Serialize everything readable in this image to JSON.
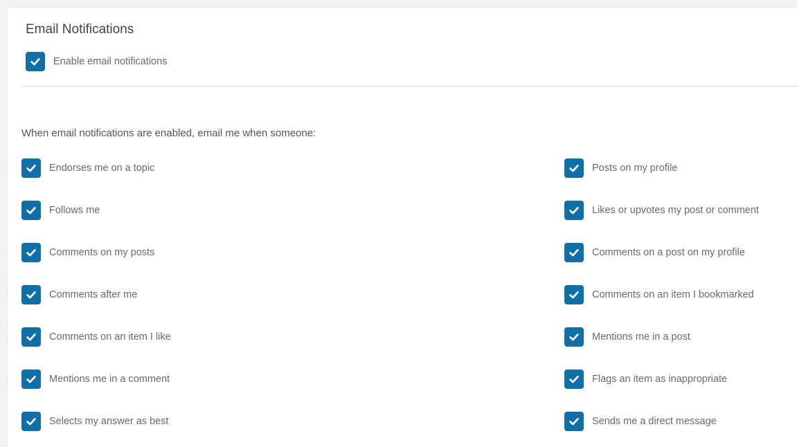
{
  "section": {
    "title": "Email Notifications",
    "enable_label": "Enable email notifications",
    "enable_checked": true
  },
  "intro": "When email notifications are enabled, email me when someone:",
  "options": {
    "left": [
      {
        "label": "Endorses me on a topic",
        "checked": true
      },
      {
        "label": "Follows me",
        "checked": true
      },
      {
        "label": "Comments on my posts",
        "checked": true
      },
      {
        "label": "Comments after me",
        "checked": true
      },
      {
        "label": "Comments on an item I like",
        "checked": true
      },
      {
        "label": "Mentions me in a comment",
        "checked": true
      },
      {
        "label": "Selects my answer as best",
        "checked": true
      }
    ],
    "right": [
      {
        "label": "Posts on my profile",
        "checked": true
      },
      {
        "label": "Likes or upvotes my post or comment",
        "checked": true
      },
      {
        "label": "Comments on a post on my profile",
        "checked": true
      },
      {
        "label": "Comments on an item I bookmarked",
        "checked": true
      },
      {
        "label": "Mentions me in a post",
        "checked": true
      },
      {
        "label": "Flags an item as inappropriate",
        "checked": true
      },
      {
        "label": "Sends me a direct message",
        "checked": true
      }
    ]
  },
  "colors": {
    "checkbox_fill": "#0f6fa8",
    "check_mark": "#ffffff"
  },
  "icons": {
    "checkbox": "check-icon"
  }
}
